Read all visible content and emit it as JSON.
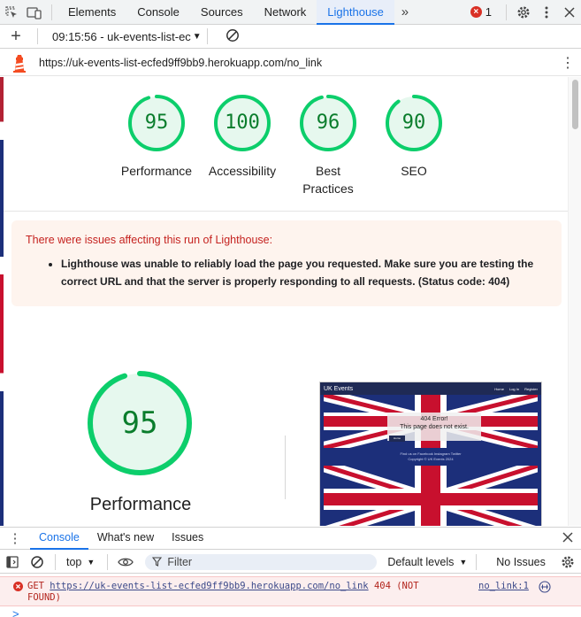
{
  "devtools": {
    "tabs": [
      "Elements",
      "Console",
      "Sources",
      "Network",
      "Lighthouse"
    ],
    "active_tab": "Lighthouse",
    "more_tabs_glyph": "»",
    "error_count": "1",
    "icons": [
      "inspect-icon",
      "device-toggle-icon",
      "settings-icon",
      "more-vert-icon",
      "close-icon"
    ]
  },
  "report_bar": {
    "new_report_glyph": "+",
    "selected_report": "09:15:56 - uk-events-list-ec",
    "dropdown_glyph": "▼"
  },
  "url_bar": {
    "url": "https://uk-events-list-ecfed9ff9bb9.herokuapp.com/no_link",
    "menu_glyph": "⋮"
  },
  "scores": [
    {
      "label": "Performance",
      "value": "95"
    },
    {
      "label": "Accessibility",
      "value": "100"
    },
    {
      "label": "Best Practices",
      "value": "96"
    },
    {
      "label": "SEO",
      "value": "90"
    }
  ],
  "warning": {
    "title": "There were issues affecting this run of Lighthouse:",
    "items": [
      "Lighthouse was unable to reliably load the page you requested. Make sure you are testing the correct URL and that the server is properly responding to all requests. (Status code: 404)"
    ]
  },
  "performance": {
    "score": "95",
    "label": "Performance"
  },
  "screenshot": {
    "site_name": "UK Events",
    "nav_links": [
      "Home",
      "Log In",
      "Register"
    ],
    "error_title": "404 Error!",
    "error_text": "This page does not exist.",
    "button": "Home",
    "footer_social": "Find us on Facebook Instagram Twitter",
    "copyright": "Copyright © UK Events 2024"
  },
  "drawer": {
    "menu_glyph": "⋮",
    "tabs": [
      "Console",
      "What's new",
      "Issues"
    ],
    "active_tab": "Console"
  },
  "console_toolbar": {
    "context": "top",
    "filter_placeholder": "Filter",
    "levels": "Default levels",
    "issues": "No Issues"
  },
  "console": {
    "messages": [
      {
        "method": "GET",
        "url": "https://uk-events-list-ecfed9ff9bb9.herokuapp.com/no_link",
        "status": "404 (NOT",
        "status_cont": "FOUND)",
        "source": "no_link:1"
      }
    ],
    "prompt": ">"
  },
  "colors": {
    "accent": "#1a73e8",
    "pass_green": "#0cce6b",
    "error_red": "#d93025",
    "warning_bg": "#fef4ee"
  }
}
